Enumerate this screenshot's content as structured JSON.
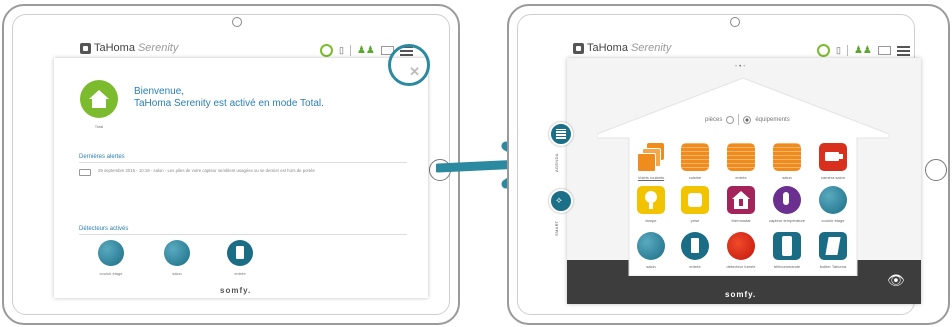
{
  "left": {
    "brand": "TaHoma",
    "brand_suffix": "Serenity",
    "close_icon": "close-icon",
    "welcome_title": "Bienvenue,",
    "welcome_text": "TaHoma Serenity est activé en mode Total.",
    "mode_label": "Total",
    "alerts_title": "Dernières alertes",
    "alert_text": "29 septembre 2015 - 10:19 - salon - Les piles de votre capteur semblent usagées ou se dernier est hors de portée",
    "detectors_title": "Détecteurs activés",
    "detectors": [
      {
        "label": "couloir étage"
      },
      {
        "label": "salon"
      },
      {
        "label": "entrée"
      }
    ],
    "footer": "somfy."
  },
  "right": {
    "brand": "TaHoma",
    "brand_suffix": "Serenity",
    "toggle_rooms": "pièces",
    "toggle_devices": "équipements",
    "agenda_label": "AGENDA",
    "smart_label": "SMART",
    "footer": "somfy.",
    "devices": [
      {
        "label": "Volets roulants"
      },
      {
        "label": "cuisine"
      },
      {
        "label": "entrée"
      },
      {
        "label": "salon"
      },
      {
        "label": "caméra salon"
      },
      {
        "label": "lampe"
      },
      {
        "label": "prise"
      },
      {
        "label": "thermostat"
      },
      {
        "label": "capteur température"
      },
      {
        "label": "couloir étage"
      },
      {
        "label": "salon"
      },
      {
        "label": "entrée"
      },
      {
        "label": "détecteur fumée"
      },
      {
        "label": "télécommande"
      },
      {
        "label": "boitier Tahoma"
      }
    ]
  },
  "colors": {
    "accent": "#2b8aa0",
    "green": "#7dbb2e",
    "orange": "#f08c1e",
    "yellow": "#f2c400",
    "purple": "#6b2f8f",
    "red": "#d9301e",
    "teal": "#1a6d85"
  }
}
